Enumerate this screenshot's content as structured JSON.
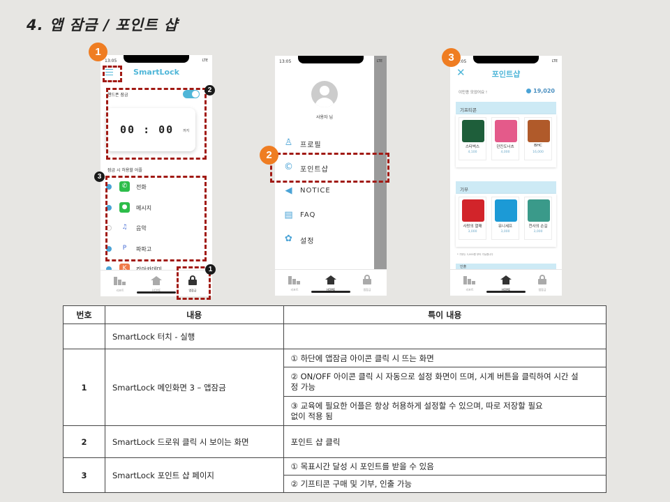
{
  "slide_title": "4. 앱 잠금 / 포인트 샵",
  "markers": {
    "m1": "1",
    "m2": "2",
    "m3": "3",
    "b1": "1",
    "b2": "2",
    "b3": "3"
  },
  "status_time": "13:05",
  "status_signal": "LTE",
  "phone1": {
    "title": "SmartLock",
    "toggle_label": "핸드폰 잠금",
    "toggle_on": true,
    "timer": "00 : 00",
    "timer_unit": "까지",
    "allowed_header": "잠금 시 허용할 어플",
    "apps": [
      {
        "name": "전화",
        "enabled": true,
        "icon": "phone-icon",
        "icon_color": "#2dbd4a",
        "glyph": "✆"
      },
      {
        "name": "메시지",
        "enabled": true,
        "icon": "message-icon",
        "icon_color": "#2dbd4a",
        "glyph": "●"
      },
      {
        "name": "음악",
        "enabled": false,
        "icon": "music-icon",
        "icon_color": "#ffffff",
        "glyph": "♫"
      },
      {
        "name": "파파고",
        "enabled": true,
        "icon": "papago-icon",
        "icon_color": "#ffffff",
        "glyph": "P"
      },
      {
        "name": "칸아카데미",
        "enabled": true,
        "icon": "khan-icon",
        "icon_color": "#f07a4a",
        "glyph": "K"
      }
    ]
  },
  "phone2": {
    "user_name": "사용자 님",
    "menu": [
      {
        "label": "프로필",
        "icon": "person-icon",
        "glyph": "♙"
      },
      {
        "label": "포인트샵",
        "icon": "copyright-icon",
        "glyph": "©"
      },
      {
        "label": "NOTICE",
        "icon": "megaphone-icon",
        "glyph": "◀"
      },
      {
        "label": "FAQ",
        "icon": "faq-icon",
        "glyph": "▤"
      },
      {
        "label": "설정",
        "icon": "gear-icon",
        "glyph": "✿"
      }
    ]
  },
  "phone3": {
    "title": "포인트샵",
    "subtitle": "이민종 모았어요 !",
    "points": "19,020",
    "giftcon_header": "기프티콘",
    "giftcons": [
      {
        "name": "스타벅스",
        "price": "4,100",
        "color": "#1e5e3a"
      },
      {
        "name": "던킨도너츠",
        "price": "4,000",
        "color": "#e45a8a"
      },
      {
        "name": "BHC",
        "price": "16,000",
        "color": "#b05a2a"
      }
    ],
    "donate_header": "기부",
    "donations": [
      {
        "name": "사랑의 열매",
        "price": "3,000",
        "color": "#d2242a"
      },
      {
        "name": "유니세프",
        "price": "3,000",
        "color": "#1c9ad6"
      },
      {
        "name": "천사의 손길",
        "price": "3,000",
        "color": "#3a9a8a"
      }
    ],
    "note": "* 기부는 3,000원 부터 가능합니다",
    "next_header": "인출"
  },
  "tabbar": {
    "stats": "리포트",
    "home": "HOME",
    "lock": "앱잠금"
  },
  "table": {
    "headers": [
      "번호",
      "내용",
      "특이 내용"
    ],
    "row0": {
      "num": "",
      "content": "SmartLock 터치 - 실행",
      "note": ""
    },
    "row1": {
      "num": "1",
      "content": "SmartLock 메인화면 3 – 앱잠금",
      "notes": [
        "① 하단에 앱잠금 아이콘 클릭 시 뜨는 화면",
        "② ON/OFF 아이콘 클릭 시 자동으로 설정 화면이 뜨며, 시계 버튼을 클릭하여 시간 설정 가능",
        "③ 교육에 필요한 어플은 항상 허용하게 설정할 수 있으며, 따로 저장할 필요없이 적용 됨"
      ]
    },
    "row2": {
      "num": "2",
      "content": "SmartLock 드로워 클릭 시 보이는 화면",
      "note": "포인트 샵 클릭"
    },
    "row3": {
      "num": "3",
      "content": "SmartLock 포인트 샵 페이지",
      "notes": [
        "① 목표시간 달성 시 포인트를 받을 수 있음",
        "② 기프티콘 구매 및 기부, 인출 가능"
      ]
    }
  }
}
